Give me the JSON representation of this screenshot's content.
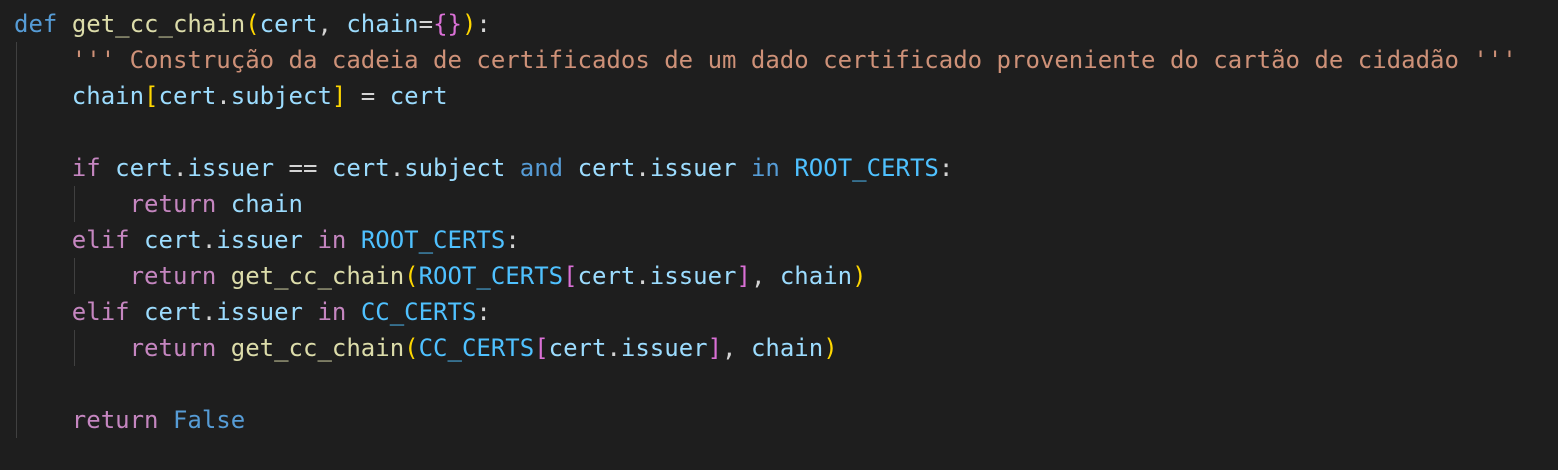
{
  "editor": {
    "theme": {
      "background": "#1e1e1e",
      "keyword": "#569cd6",
      "control": "#c586c0",
      "function": "#dcdcaa",
      "variable": "#9cdcfe",
      "constant": "#4fc1ff",
      "string": "#ce9178",
      "bracket1": "#ffd700",
      "bracket2": "#da70d6",
      "bracket3": "#179fff"
    },
    "lines": [
      [
        {
          "t": "def",
          "c": "kw"
        },
        {
          "t": " ",
          "c": "op"
        },
        {
          "t": "get_cc_chain",
          "c": "fn"
        },
        {
          "t": "(",
          "c": "br1"
        },
        {
          "t": "cert",
          "c": "var"
        },
        {
          "t": ", ",
          "c": "op"
        },
        {
          "t": "chain",
          "c": "var"
        },
        {
          "t": "=",
          "c": "op"
        },
        {
          "t": "{}",
          "c": "br2"
        },
        {
          "t": ")",
          "c": "br1"
        },
        {
          "t": ":",
          "c": "op"
        }
      ],
      [
        {
          "t": "    ",
          "c": "op"
        },
        {
          "t": "''' Construção da cadeia de certificados de um dado certificado proveniente do cartão de cidadão '''",
          "c": "str"
        }
      ],
      [
        {
          "t": "    ",
          "c": "op"
        },
        {
          "t": "chain",
          "c": "var"
        },
        {
          "t": "[",
          "c": "br1"
        },
        {
          "t": "cert",
          "c": "var"
        },
        {
          "t": ".",
          "c": "op"
        },
        {
          "t": "subject",
          "c": "var"
        },
        {
          "t": "]",
          "c": "br1"
        },
        {
          "t": " = ",
          "c": "op"
        },
        {
          "t": "cert",
          "c": "var"
        }
      ],
      [],
      [
        {
          "t": "    ",
          "c": "op"
        },
        {
          "t": "if",
          "c": "ctl"
        },
        {
          "t": " ",
          "c": "op"
        },
        {
          "t": "cert",
          "c": "var"
        },
        {
          "t": ".",
          "c": "op"
        },
        {
          "t": "issuer",
          "c": "var"
        },
        {
          "t": " == ",
          "c": "op"
        },
        {
          "t": "cert",
          "c": "var"
        },
        {
          "t": ".",
          "c": "op"
        },
        {
          "t": "subject",
          "c": "var"
        },
        {
          "t": " ",
          "c": "op"
        },
        {
          "t": "and",
          "c": "kw"
        },
        {
          "t": " ",
          "c": "op"
        },
        {
          "t": "cert",
          "c": "var"
        },
        {
          "t": ".",
          "c": "op"
        },
        {
          "t": "issuer",
          "c": "var"
        },
        {
          "t": " ",
          "c": "op"
        },
        {
          "t": "in",
          "c": "kw"
        },
        {
          "t": " ",
          "c": "op"
        },
        {
          "t": "ROOT_CERTS",
          "c": "const"
        },
        {
          "t": ":",
          "c": "op"
        }
      ],
      [
        {
          "t": "        ",
          "c": "op"
        },
        {
          "t": "return",
          "c": "ctl"
        },
        {
          "t": " ",
          "c": "op"
        },
        {
          "t": "chain",
          "c": "var"
        }
      ],
      [
        {
          "t": "    ",
          "c": "op"
        },
        {
          "t": "elif",
          "c": "ctl"
        },
        {
          "t": " ",
          "c": "op"
        },
        {
          "t": "cert",
          "c": "var"
        },
        {
          "t": ".",
          "c": "op"
        },
        {
          "t": "issuer",
          "c": "var"
        },
        {
          "t": " ",
          "c": "op"
        },
        {
          "t": "in",
          "c": "ctl"
        },
        {
          "t": " ",
          "c": "op"
        },
        {
          "t": "ROOT_CERTS",
          "c": "const"
        },
        {
          "t": ":",
          "c": "op"
        }
      ],
      [
        {
          "t": "        ",
          "c": "op"
        },
        {
          "t": "return",
          "c": "ctl"
        },
        {
          "t": " ",
          "c": "op"
        },
        {
          "t": "get_cc_chain",
          "c": "fn"
        },
        {
          "t": "(",
          "c": "br1"
        },
        {
          "t": "ROOT_CERTS",
          "c": "const"
        },
        {
          "t": "[",
          "c": "br2"
        },
        {
          "t": "cert",
          "c": "var"
        },
        {
          "t": ".",
          "c": "op"
        },
        {
          "t": "issuer",
          "c": "var"
        },
        {
          "t": "]",
          "c": "br2"
        },
        {
          "t": ", ",
          "c": "op"
        },
        {
          "t": "chain",
          "c": "var"
        },
        {
          "t": ")",
          "c": "br1"
        }
      ],
      [
        {
          "t": "    ",
          "c": "op"
        },
        {
          "t": "elif",
          "c": "ctl"
        },
        {
          "t": " ",
          "c": "op"
        },
        {
          "t": "cert",
          "c": "var"
        },
        {
          "t": ".",
          "c": "op"
        },
        {
          "t": "issuer",
          "c": "var"
        },
        {
          "t": " ",
          "c": "op"
        },
        {
          "t": "in",
          "c": "ctl"
        },
        {
          "t": " ",
          "c": "op"
        },
        {
          "t": "CC_CERTS",
          "c": "const"
        },
        {
          "t": ":",
          "c": "op"
        }
      ],
      [
        {
          "t": "        ",
          "c": "op"
        },
        {
          "t": "return",
          "c": "ctl"
        },
        {
          "t": " ",
          "c": "op"
        },
        {
          "t": "get_cc_chain",
          "c": "fn"
        },
        {
          "t": "(",
          "c": "br1"
        },
        {
          "t": "CC_CERTS",
          "c": "const"
        },
        {
          "t": "[",
          "c": "br2"
        },
        {
          "t": "cert",
          "c": "var"
        },
        {
          "t": ".",
          "c": "op"
        },
        {
          "t": "issuer",
          "c": "var"
        },
        {
          "t": "]",
          "c": "br2"
        },
        {
          "t": ", ",
          "c": "op"
        },
        {
          "t": "chain",
          "c": "var"
        },
        {
          "t": ")",
          "c": "br1"
        }
      ],
      [],
      [
        {
          "t": "    ",
          "c": "op"
        },
        {
          "t": "return",
          "c": "ctl"
        },
        {
          "t": " ",
          "c": "op"
        },
        {
          "t": "False",
          "c": "kw"
        }
      ]
    ]
  }
}
